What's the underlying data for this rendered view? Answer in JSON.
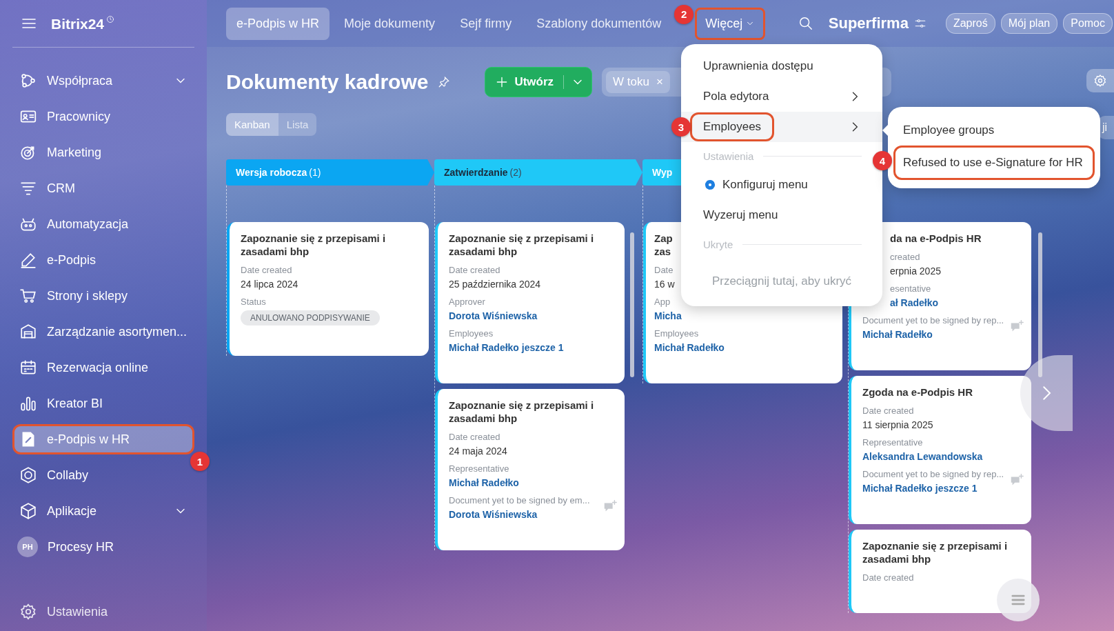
{
  "sidebar": {
    "logo": "Bitrix24",
    "items": [
      {
        "label": "Współpraca",
        "submenu": true,
        "selected": false
      },
      {
        "label": "Pracownicy",
        "submenu": false,
        "selected": false
      },
      {
        "label": "Marketing",
        "submenu": false,
        "selected": false
      },
      {
        "label": "CRM",
        "submenu": false,
        "selected": false
      },
      {
        "label": "Automatyzacja",
        "submenu": false,
        "selected": false
      },
      {
        "label": "e-Podpis",
        "submenu": false,
        "selected": false
      },
      {
        "label": "Strony i sklepy",
        "submenu": false,
        "selected": false
      },
      {
        "label": "Zarządzanie asortymen...",
        "submenu": false,
        "selected": false
      },
      {
        "label": "Rezerwacja online",
        "submenu": false,
        "selected": false
      },
      {
        "label": "Kreator BI",
        "submenu": false,
        "selected": false
      },
      {
        "label": "e-Podpis w HR",
        "submenu": false,
        "selected": true,
        "callout": "1"
      },
      {
        "label": "Collaby",
        "submenu": false,
        "selected": false
      },
      {
        "label": "Aplikacje",
        "submenu": true,
        "selected": false
      },
      {
        "label": "Procesy HR",
        "avatar": "PH",
        "submenu": false,
        "selected": false
      }
    ],
    "footer_item": "Ustawienia"
  },
  "topbar": {
    "tabs": [
      {
        "label": "e-Podpis w HR",
        "selected": true
      },
      {
        "label": "Moje dokumenty",
        "selected": false
      },
      {
        "label": "Sejf firmy",
        "selected": false
      },
      {
        "label": "Szablony dokumentów",
        "selected": false
      },
      {
        "label": "Więcej",
        "selected": false,
        "callout": "2"
      }
    ],
    "company": "Superfirma",
    "buttons": [
      "Zaproś",
      "Mój plan",
      "Pomoc"
    ]
  },
  "header": {
    "title": "Dokumenty kadrowe",
    "create_button": "Utwórz",
    "filter_chip": "W toku",
    "chip_close": "×",
    "views": [
      {
        "label": "Kanban",
        "selected": true
      },
      {
        "label": "Lista",
        "selected": false
      }
    ],
    "side_button": "ji"
  },
  "kanban": {
    "columns": [
      {
        "title": "Wersja robocza",
        "count": "(1)",
        "color": "#0ba6f2",
        "scrollbar": false,
        "cards": [
          {
            "title": "Zapoznanie się z przepisami i zasadami bhp",
            "fields": [
              {
                "label": "Date created",
                "value": "24 lipca 2024",
                "kind": "text"
              },
              {
                "label": "Status",
                "value": "ANULOWANO PODPISYWANIE",
                "kind": "tag"
              }
            ]
          }
        ]
      },
      {
        "title": "Zatwierdzanie",
        "count": "(2)",
        "color": "#1fc8f7",
        "scrollbar": true,
        "cards": [
          {
            "title": "Zapoznanie się z przepisami i zasadami bhp",
            "fields": [
              {
                "label": "Date created",
                "value": "25 października 2024",
                "kind": "text"
              },
              {
                "label": "Approver",
                "value": "Dorota Wiśniewska",
                "kind": "link"
              },
              {
                "label": "Employees",
                "value": "Michał Radełko jeszcze 1",
                "kind": "link"
              }
            ]
          },
          {
            "title": "Zapoznanie się z przepisami i zasadami bhp",
            "comment": true,
            "fields": [
              {
                "label": "Date created",
                "value": "24 maja 2024",
                "kind": "text"
              },
              {
                "label": "Representative",
                "value": "Michał Radełko",
                "kind": "link"
              },
              {
                "label": "Document yet to be signed by em...",
                "value": "Dorota Wiśniewska",
                "kind": "link"
              }
            ]
          }
        ]
      },
      {
        "title": "Wyp",
        "color": "#1fc8f7",
        "scrollbar": false,
        "cards": [
          {
            "title": "Zap\nzas",
            "fields": [
              {
                "label": "Date",
                "value": "16 w",
                "kind": "text"
              },
              {
                "label": "App",
                "value": "Micha",
                "kind": "link"
              },
              {
                "label": "Employees",
                "value": "Michał Radełko",
                "kind": "link"
              }
            ]
          }
        ]
      },
      {
        "color": "#1fc8f7",
        "scrollbar": true,
        "cards": [
          {
            "title": "da na e-Podpis HR",
            "covered": true,
            "comment": true,
            "fields": [
              {
                "label": "created",
                "value": "erpnia 2025",
                "kind": "text",
                "covered": true
              },
              {
                "label": "esentative",
                "value": "ał Radełko",
                "kind": "link",
                "covered": true
              },
              {
                "label": "Document yet to be signed by rep...",
                "value": "Michał Radełko",
                "kind": "link",
                "covered": false
              }
            ]
          },
          {
            "title": "Zgoda na e-Podpis HR",
            "comment": true,
            "fields": [
              {
                "label": "Date created",
                "value": "11 sierpnia 2025",
                "kind": "text"
              },
              {
                "label": "Representative",
                "value": "Aleksandra Lewandowska",
                "kind": "link"
              },
              {
                "label": "Document yet to be signed by rep...",
                "value": "Michał Radełko jeszcze 1",
                "kind": "link"
              }
            ]
          },
          {
            "title": "Zapoznanie się z przepisami i zasadami bhp",
            "fields": [
              {
                "label": "Date created",
                "kind": "text"
              }
            ]
          }
        ]
      }
    ]
  },
  "menu": {
    "items": [
      {
        "kind": "item",
        "label": "Uprawnienia dostępu",
        "submenu": false,
        "hover": false
      },
      {
        "kind": "item",
        "label": "Pola edytora",
        "submenu": true,
        "hover": false
      },
      {
        "kind": "item",
        "label": "Employees",
        "submenu": true,
        "hover": true,
        "callout": "3"
      },
      {
        "kind": "section",
        "label": "Ustawienia"
      },
      {
        "kind": "gear-item",
        "label": "Konfiguruj menu",
        "submenu": false,
        "hover": false
      },
      {
        "kind": "item",
        "label": "Wyzeruj menu",
        "submenu": false,
        "hover": false
      },
      {
        "kind": "section",
        "label": "Ukryte"
      },
      {
        "kind": "hint",
        "label": "Przeciągnij tutaj, aby ukryć"
      }
    ]
  },
  "submenu": {
    "items": [
      {
        "label": "Employee groups"
      },
      {
        "label": "Refused to use e-Signature for HR",
        "callout": "4"
      }
    ]
  }
}
